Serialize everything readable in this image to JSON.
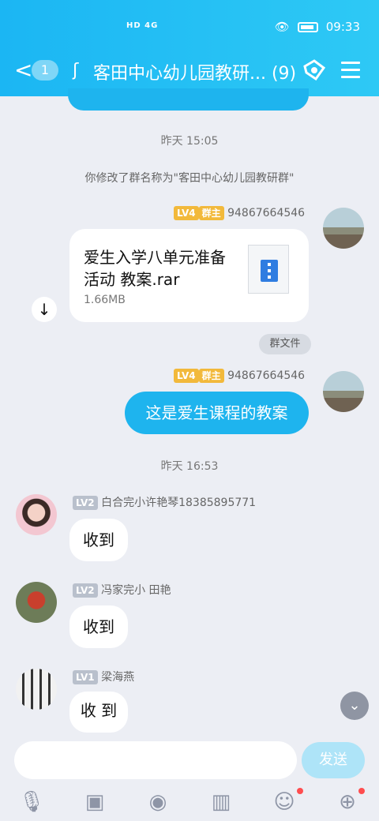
{
  "status_bar": {
    "signal": "HD 4G",
    "time": "09:33"
  },
  "header": {
    "unread_count": "1",
    "title": "客田中心幼儿园教研... (9)"
  },
  "timestamps": [
    "昨天 15:05",
    "昨天 16:53"
  ],
  "system_message": "你修改了群名称为\"客田中心幼儿园教研群\"",
  "messages": [
    {
      "level": "LV4",
      "role": "群主",
      "sender": "94867664546",
      "file_name": "爱生入学八单元准备活动  教案.rar",
      "file_size": "1.66MB",
      "tag": "群文件"
    },
    {
      "level": "LV4",
      "role": "群主",
      "sender": "94867664546",
      "text": "这是爱生课程的教案"
    },
    {
      "level": "LV2",
      "sender": "白合完小许艳琴18385895771",
      "text": "收到"
    },
    {
      "level": "LV2",
      "sender": "冯家完小 田艳",
      "text": "收到"
    },
    {
      "level": "LV1",
      "sender": "梁海燕",
      "text": "收 到"
    }
  ],
  "input": {
    "placeholder": "",
    "send_label": "发送"
  },
  "toolbar_icons": [
    "microphone-icon",
    "image-icon",
    "camera-icon",
    "red-packet-icon",
    "emoji-icon",
    "plus-icon"
  ]
}
